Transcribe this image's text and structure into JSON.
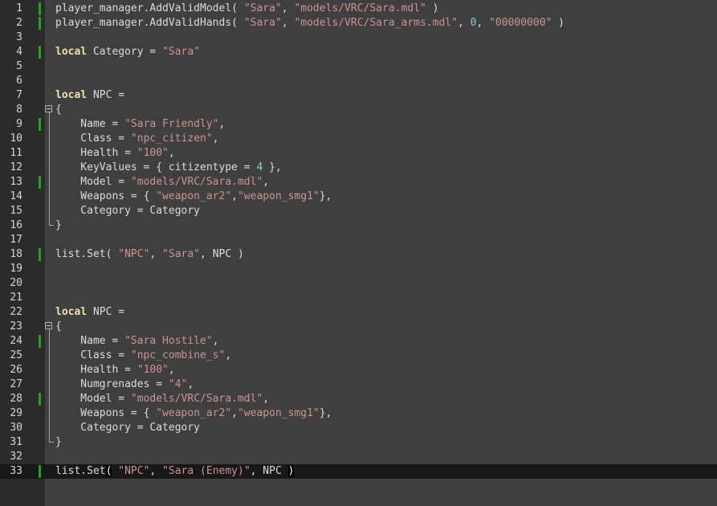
{
  "lines": [
    {
      "n": "1",
      "changed": true,
      "tokens": [
        {
          "t": "player_manager.AddValidModel( ",
          "c": "op"
        },
        {
          "t": "\"Sara\"",
          "c": "str"
        },
        {
          "t": ", ",
          "c": "op"
        },
        {
          "t": "\"models/VRC/Sara.mdl\"",
          "c": "str"
        },
        {
          "t": " )",
          "c": "op"
        }
      ]
    },
    {
      "n": "2",
      "changed": true,
      "tokens": [
        {
          "t": "player_manager.AddValidHands( ",
          "c": "op"
        },
        {
          "t": "\"Sara\"",
          "c": "str"
        },
        {
          "t": ", ",
          "c": "op"
        },
        {
          "t": "\"models/VRC/Sara_arms.mdl\"",
          "c": "str"
        },
        {
          "t": ", ",
          "c": "op"
        },
        {
          "t": "0",
          "c": "num"
        },
        {
          "t": ", ",
          "c": "op"
        },
        {
          "t": "\"00000000\"",
          "c": "str"
        },
        {
          "t": " )",
          "c": "op"
        }
      ]
    },
    {
      "n": "3",
      "changed": false,
      "tokens": []
    },
    {
      "n": "4",
      "changed": true,
      "tokens": [
        {
          "t": "local",
          "c": "kw"
        },
        {
          "t": " Category = ",
          "c": "op"
        },
        {
          "t": "\"Sara\"",
          "c": "str"
        }
      ]
    },
    {
      "n": "5",
      "changed": false,
      "tokens": []
    },
    {
      "n": "6",
      "changed": false,
      "tokens": []
    },
    {
      "n": "7",
      "changed": false,
      "tokens": [
        {
          "t": "local",
          "c": "kw"
        },
        {
          "t": " NPC =",
          "c": "op"
        }
      ]
    },
    {
      "n": "8",
      "changed": false,
      "fold": "start",
      "tokens": [
        {
          "t": "{",
          "c": "op"
        }
      ]
    },
    {
      "n": "9",
      "changed": true,
      "fold": "mid",
      "tokens": [
        {
          "t": "    Name = ",
          "c": "op"
        },
        {
          "t": "\"Sara Friendly\"",
          "c": "str"
        },
        {
          "t": ",",
          "c": "op"
        }
      ]
    },
    {
      "n": "10",
      "changed": false,
      "fold": "mid",
      "tokens": [
        {
          "t": "    Class = ",
          "c": "op"
        },
        {
          "t": "\"npc_citizen\"",
          "c": "str"
        },
        {
          "t": ",",
          "c": "op"
        }
      ]
    },
    {
      "n": "11",
      "changed": false,
      "fold": "mid",
      "tokens": [
        {
          "t": "    Health = ",
          "c": "op"
        },
        {
          "t": "\"100\"",
          "c": "str"
        },
        {
          "t": ",",
          "c": "op"
        }
      ]
    },
    {
      "n": "12",
      "changed": false,
      "fold": "mid",
      "tokens": [
        {
          "t": "    KeyValues = { citizentype = ",
          "c": "op"
        },
        {
          "t": "4",
          "c": "num"
        },
        {
          "t": " },",
          "c": "op"
        }
      ]
    },
    {
      "n": "13",
      "changed": true,
      "fold": "mid",
      "tokens": [
        {
          "t": "    Model = ",
          "c": "op"
        },
        {
          "t": "\"models/VRC/Sara.mdl\"",
          "c": "str"
        },
        {
          "t": ",",
          "c": "op"
        }
      ]
    },
    {
      "n": "14",
      "changed": false,
      "fold": "mid",
      "tokens": [
        {
          "t": "    Weapons = { ",
          "c": "op"
        },
        {
          "t": "\"weapon_ar2\"",
          "c": "str"
        },
        {
          "t": ",",
          "c": "op"
        },
        {
          "t": "\"weapon_smg1\"",
          "c": "str"
        },
        {
          "t": "},",
          "c": "op"
        }
      ]
    },
    {
      "n": "15",
      "changed": false,
      "fold": "mid",
      "tokens": [
        {
          "t": "    Category = Category",
          "c": "op"
        }
      ]
    },
    {
      "n": "16",
      "changed": false,
      "fold": "end",
      "tokens": [
        {
          "t": "}",
          "c": "op"
        }
      ]
    },
    {
      "n": "17",
      "changed": false,
      "tokens": []
    },
    {
      "n": "18",
      "changed": true,
      "tokens": [
        {
          "t": "list.Set( ",
          "c": "op"
        },
        {
          "t": "\"NPC\"",
          "c": "str"
        },
        {
          "t": ", ",
          "c": "op"
        },
        {
          "t": "\"Sara\"",
          "c": "str"
        },
        {
          "t": ", NPC )",
          "c": "op"
        }
      ]
    },
    {
      "n": "19",
      "changed": false,
      "tokens": []
    },
    {
      "n": "20",
      "changed": false,
      "tokens": []
    },
    {
      "n": "21",
      "changed": false,
      "tokens": []
    },
    {
      "n": "22",
      "changed": false,
      "tokens": [
        {
          "t": "local",
          "c": "kw"
        },
        {
          "t": " NPC =",
          "c": "op"
        }
      ]
    },
    {
      "n": "23",
      "changed": false,
      "fold": "start",
      "tokens": [
        {
          "t": "{",
          "c": "op"
        }
      ]
    },
    {
      "n": "24",
      "changed": true,
      "fold": "mid",
      "tokens": [
        {
          "t": "    Name = ",
          "c": "op"
        },
        {
          "t": "\"Sara Hostile\"",
          "c": "str"
        },
        {
          "t": ",",
          "c": "op"
        }
      ]
    },
    {
      "n": "25",
      "changed": false,
      "fold": "mid",
      "tokens": [
        {
          "t": "    Class = ",
          "c": "op"
        },
        {
          "t": "\"npc_combine_s\"",
          "c": "str"
        },
        {
          "t": ",",
          "c": "op"
        }
      ]
    },
    {
      "n": "26",
      "changed": false,
      "fold": "mid",
      "tokens": [
        {
          "t": "    Health = ",
          "c": "op"
        },
        {
          "t": "\"100\"",
          "c": "str"
        },
        {
          "t": ",",
          "c": "op"
        }
      ]
    },
    {
      "n": "27",
      "changed": false,
      "fold": "mid",
      "tokens": [
        {
          "t": "    Numgrenades = ",
          "c": "op"
        },
        {
          "t": "\"4\"",
          "c": "str"
        },
        {
          "t": ",",
          "c": "op"
        }
      ]
    },
    {
      "n": "28",
      "changed": true,
      "fold": "mid",
      "tokens": [
        {
          "t": "    Model = ",
          "c": "op"
        },
        {
          "t": "\"models/VRC/Sara.mdl\"",
          "c": "str"
        },
        {
          "t": ",",
          "c": "op"
        }
      ]
    },
    {
      "n": "29",
      "changed": false,
      "fold": "mid",
      "tokens": [
        {
          "t": "    Weapons = { ",
          "c": "op"
        },
        {
          "t": "\"weapon_ar2\"",
          "c": "str"
        },
        {
          "t": ",",
          "c": "op"
        },
        {
          "t": "\"weapon_smg1\"",
          "c": "str"
        },
        {
          "t": "},",
          "c": "op"
        }
      ]
    },
    {
      "n": "30",
      "changed": false,
      "fold": "mid",
      "tokens": [
        {
          "t": "    Category = Category",
          "c": "op"
        }
      ]
    },
    {
      "n": "31",
      "changed": false,
      "fold": "end",
      "tokens": [
        {
          "t": "}",
          "c": "op"
        }
      ]
    },
    {
      "n": "32",
      "changed": false,
      "tokens": []
    },
    {
      "n": "33",
      "changed": true,
      "current": true,
      "tokens": [
        {
          "t": "list.Set",
          "c": "op"
        },
        {
          "t": "(",
          "c": "bracehl"
        },
        {
          "t": " ",
          "c": "op"
        },
        {
          "t": "\"NPC\"",
          "c": "str"
        },
        {
          "t": ", ",
          "c": "op"
        },
        {
          "t": "\"Sara (Enemy)\"",
          "c": "str"
        },
        {
          "t": ", NPC ",
          "c": "op"
        },
        {
          "t": ")",
          "c": "bracehl"
        }
      ]
    }
  ],
  "colors": {
    "editor_bg": "#3f3f3f",
    "gutter_bg": "#2b2b2b",
    "current_line_bg": "#181818",
    "change_bar": "#1fa51f",
    "keyword": "#f0dfaf",
    "string": "#cc9393",
    "number": "#8cd0d3",
    "default": "#dcdcdc"
  }
}
